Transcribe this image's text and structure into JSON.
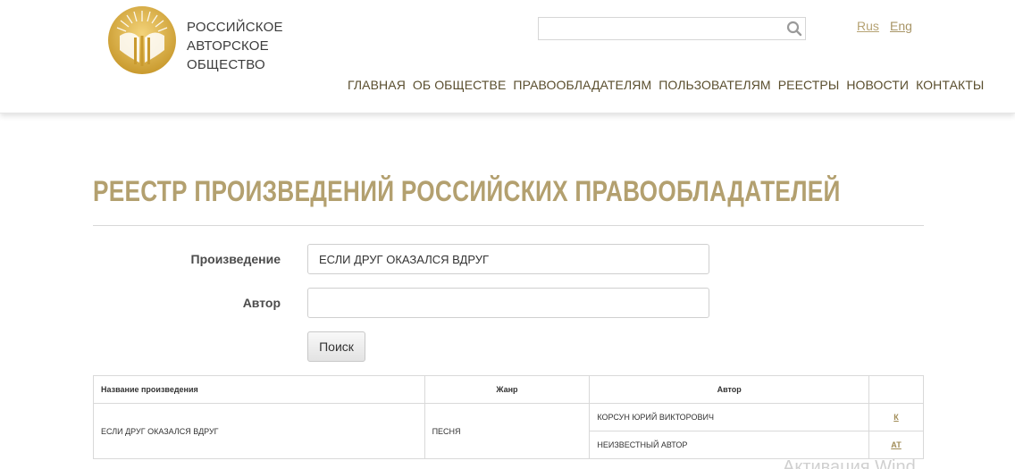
{
  "header": {
    "org_name": [
      "РОССИЙСКОЕ",
      "АВТОРСКОЕ",
      "ОБЩЕСТВО"
    ],
    "search": {
      "value": "",
      "placeholder": ""
    },
    "languages": [
      "Rus",
      "Eng"
    ],
    "nav": [
      "ГЛАВНАЯ",
      "ОБ ОБЩЕСТВЕ",
      "ПРАВООБЛАДАТЕЛЯМ",
      "ПОЛЬЗОВАТЕЛЯМ",
      "РЕЕСТРЫ",
      "НОВОСТИ",
      "КОНТАКТЫ"
    ]
  },
  "page": {
    "title": "РЕЕСТР ПРОИЗВЕДЕНИЙ РОССИЙСКИХ ПРАВООБЛАДАТЕЛЕЙ"
  },
  "form": {
    "work_label": "Произведение",
    "work_value": "ЕСЛИ ДРУГ ОКАЗАЛСЯ ВДРУГ",
    "author_label": "Автор",
    "author_value": "",
    "search_button": "Поиск"
  },
  "table": {
    "headers": [
      "Название произведения",
      "Жанр",
      "Автор",
      ""
    ],
    "row": {
      "name": "ЕСЛИ ДРУГ ОКАЗАЛСЯ ВДРУГ",
      "genre": "ПЕСНЯ",
      "authors": [
        {
          "name": "КОРСУН ЮРИЙ ВИКТОРОВИЧ",
          "role": "К"
        },
        {
          "name": "НЕИЗВЕСТНЫЙ АВТОР",
          "role": "АТ"
        }
      ]
    }
  },
  "watermark": "Активация Wind",
  "colors": {
    "gold": "#b3a06f",
    "nav": "#5a4e2e",
    "link": "#a08b55"
  }
}
